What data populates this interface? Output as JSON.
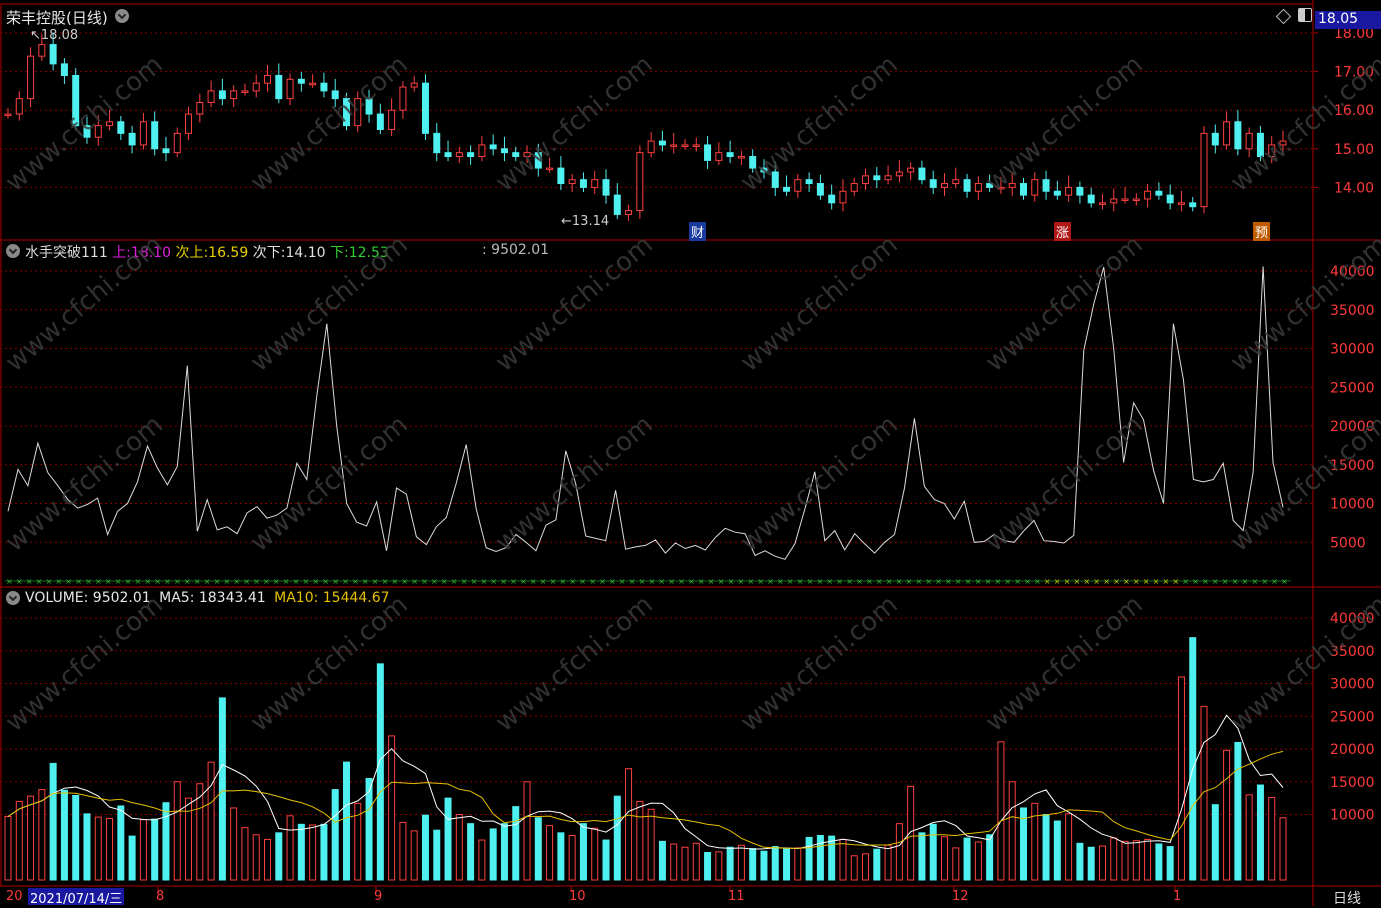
{
  "stock": {
    "name": "荣丰控股",
    "period": "(日线)",
    "current_price_badge": "18.05",
    "high_label": "18.08",
    "low_label": "13.14"
  },
  "price_axis": [
    "18.00",
    "17.00",
    "16.00",
    "15.00",
    "14.00"
  ],
  "markers": {
    "cai": "财",
    "zhang": "涨",
    "yu": "预"
  },
  "indicator": {
    "name": "水手突破111",
    "up_label": "上:",
    "up_value": "18.10",
    "sub_up_label": "次上:",
    "sub_up_value": "16.59",
    "sub_down_label": "次下:",
    "sub_down_value": "14.10",
    "down_label": "下:",
    "down_value": "12.53",
    "extra": ": 9502.01"
  },
  "indicator_axis": [
    "40000",
    "35000",
    "30000",
    "25000",
    "20000",
    "15000",
    "10000",
    "5000"
  ],
  "volume": {
    "label": "VOLUME: 9502.01",
    "ma5": "MA5: 18343.41",
    "ma10": "MA10: 15444.67"
  },
  "volume_axis": [
    "40000",
    "35000",
    "30000",
    "25000",
    "20000",
    "15000",
    "10000"
  ],
  "x_axis": {
    "start": "20",
    "cursor_date": "2021/07/14/三",
    "months": [
      "8",
      "9",
      "10",
      "11",
      "12",
      "1"
    ],
    "period_button": "日线"
  },
  "watermark": "www.cfchi.com",
  "colors": {
    "up": "#ff4040",
    "down": "#4ff0f0",
    "grid": "#8b0000",
    "ma5": "#ffffff",
    "ma10": "#e6c000"
  },
  "series": {
    "count": 114,
    "close": [
      15.9,
      16.3,
      17.4,
      17.7,
      17.2,
      16.9,
      15.6,
      15.3,
      15.6,
      15.7,
      15.4,
      15.1,
      15.7,
      15.0,
      14.9,
      15.4,
      15.9,
      16.2,
      16.5,
      16.3,
      16.5,
      16.5,
      16.7,
      16.9,
      16.3,
      16.8,
      16.7,
      16.7,
      16.5,
      16.3,
      15.6,
      16.3,
      15.9,
      15.5,
      16.0,
      16.6,
      16.7,
      15.4,
      14.9,
      14.8,
      14.9,
      14.8,
      15.1,
      15.0,
      14.9,
      14.8,
      14.9,
      14.5,
      14.5,
      14.1,
      14.2,
      14.0,
      14.2,
      13.8,
      13.3,
      13.4,
      14.9,
      15.2,
      15.1,
      15.1,
      15.1,
      15.1,
      14.7,
      14.9,
      14.8,
      14.8,
      14.5,
      14.4,
      14.0,
      13.9,
      14.2,
      14.1,
      13.8,
      13.6,
      13.9,
      14.1,
      14.3,
      14.2,
      14.3,
      14.4,
      14.5,
      14.2,
      14.0,
      14.1,
      14.2,
      13.9,
      14.1,
      14.0,
      14.0,
      14.1,
      13.8,
      14.2,
      13.9,
      13.8,
      14.0,
      13.8,
      13.6,
      13.6,
      13.7,
      13.7,
      13.7,
      13.9,
      13.8,
      13.6,
      13.6,
      13.5,
      15.4,
      15.1,
      15.7,
      15.0,
      15.4,
      14.8,
      15.1,
      15.2
    ],
    "volume": [
      9700,
      12000,
      12800,
      13800,
      17800,
      13700,
      12900,
      10100,
      9600,
      9400,
      11300,
      6700,
      9200,
      9300,
      11800,
      15000,
      12500,
      14700,
      18000,
      27800,
      11000,
      8000,
      6900,
      6200,
      7200,
      9800,
      8500,
      8400,
      8500,
      13800,
      18000,
      11700,
      15500,
      33000,
      22000,
      8800,
      7500,
      9900,
      7600,
      12500,
      10000,
      8600,
      6100,
      7800,
      8600,
      11200,
      15000,
      9500,
      8300,
      7200,
      6800,
      8600,
      7900,
      6100,
      12800,
      17000,
      12000,
      10800,
      5900,
      5500,
      5000,
      5600,
      4200,
      4300,
      5000,
      5300,
      4800,
      4400,
      5100,
      4800,
      4900,
      6500,
      6800,
      6700,
      6200,
      3700,
      4000,
      4700,
      5300,
      8600,
      14300,
      7200,
      8500,
      6600,
      4900,
      6400,
      5800,
      6900,
      21100,
      15000,
      11000,
      11700,
      10000,
      9000,
      10100,
      5600,
      5000,
      5200,
      6400,
      5900,
      6000,
      6200,
      5500,
      5100,
      31000,
      37000,
      26500,
      11500,
      19800,
      21000,
      13000,
      14500,
      12600,
      9500
    ]
  },
  "pane2": {
    "values": [
      9000,
      14400,
      12300,
      17800,
      14000,
      12300,
      10500,
      9400,
      9900,
      10700,
      6000,
      9000,
      10000,
      12800,
      17400,
      14600,
      12400,
      14800,
      27800,
      6400,
      10500,
      6600,
      7000,
      6100,
      8800,
      9600,
      8100,
      8500,
      9400,
      15200,
      13100,
      23900,
      33200,
      20000,
      10000,
      7600,
      7100,
      10200,
      3900,
      12000,
      11200,
      5700,
      4700,
      7000,
      8200,
      12600,
      17600,
      9300,
      4300,
      3800,
      4300,
      6000,
      5000,
      3900,
      7200,
      7900,
      16800,
      12500,
      5800,
      5500,
      5200,
      11700,
      4100,
      4400,
      4600,
      5300,
      3600,
      4900,
      4200,
      4600,
      4000,
      5600,
      6800,
      6300,
      6100,
      3300,
      3900,
      3200,
      2800,
      4800,
      9300,
      14100,
      5200,
      6500,
      4000,
      6100,
      4800,
      3600,
      5000,
      6000,
      12000,
      21000,
      12200,
      10500,
      10000,
      8000,
      10300,
      5000,
      5100,
      6000,
      5200,
      5000,
      6500,
      7800,
      5200,
      5100,
      4900,
      5900,
      29800,
      35700,
      40500,
      30000,
      15300,
      23000,
      20800,
      14300,
      10000,
      33200,
      26000,
      13100,
      12800,
      13100,
      15200,
      7800,
      6500,
      14000,
      40600,
      15300,
      9500
    ],
    "baseline_marks": 130
  }
}
